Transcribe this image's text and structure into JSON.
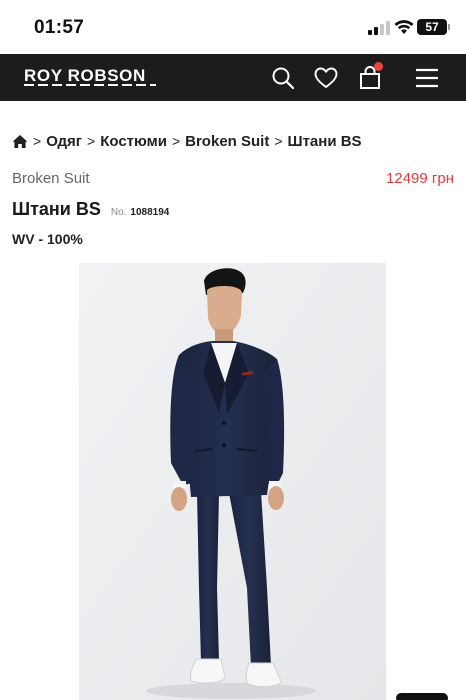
{
  "status_bar": {
    "time": "01:57",
    "battery": "57"
  },
  "header": {
    "logo": "ROY ROBSON",
    "icons": [
      "search-icon",
      "heart-icon",
      "shopping-bag-icon",
      "menu-icon"
    ],
    "background": "#1c1c1c",
    "cart_dot_color": "#e8463f"
  },
  "breadcrumb": {
    "items": [
      "Одяг",
      "Костюми",
      "Broken Suit",
      "Штани BS"
    ],
    "separator": ">"
  },
  "product": {
    "brand": "Broken Suit",
    "price": "12499 грн",
    "price_color": "#e03a3a",
    "title": "Штани BS",
    "sku_prefix": "No.",
    "sku": "1088194",
    "composition": "WV - 100%"
  }
}
